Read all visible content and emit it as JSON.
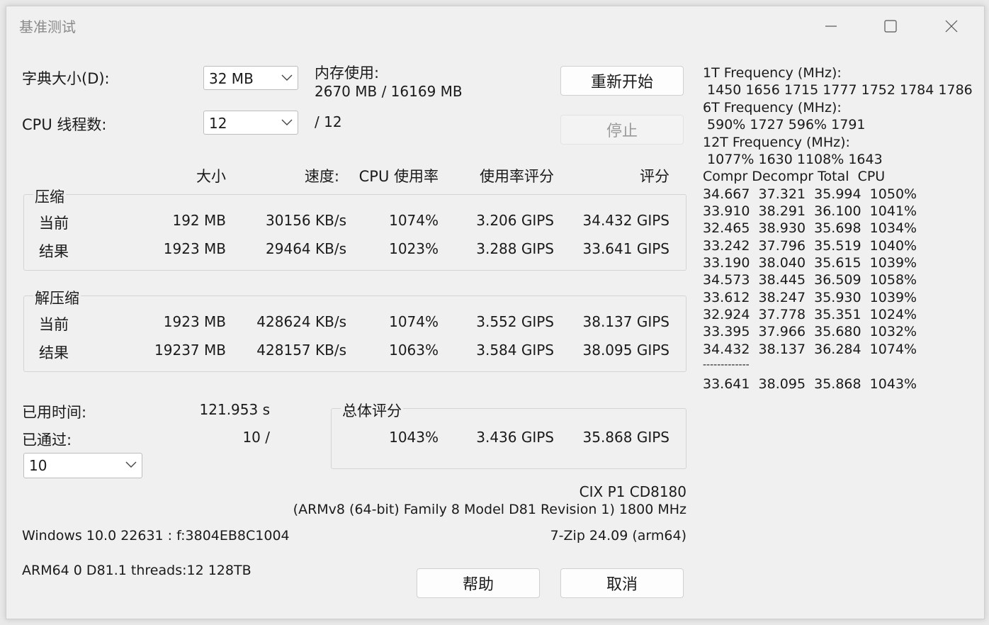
{
  "window": {
    "title": "基准测试",
    "controls": {
      "minimize": "minimize-icon",
      "maximize": "maximize-icon",
      "close": "close-icon"
    }
  },
  "settings": {
    "dict_label": "字典大小(D):",
    "dict_value": "32 MB",
    "threads_label": "CPU 线程数:",
    "threads_value": "12",
    "threads_max": "/ 12",
    "mem_label": "内存使用:",
    "mem_value": "2670 MB / 16169 MB"
  },
  "buttons": {
    "restart": "重新开始",
    "stop": "停止",
    "help": "帮助",
    "cancel": "取消"
  },
  "table": {
    "headers": {
      "size": "大小",
      "speed": "速度:",
      "cpu": "CPU 使用率",
      "usage_rating": "使用率评分",
      "rating": "评分"
    },
    "compress": {
      "title": "压缩",
      "current": {
        "label": "当前",
        "size": "192 MB",
        "speed": "30156 KB/s",
        "cpu": "1074%",
        "usage_rating": "3.206 GIPS",
        "rating": "34.432 GIPS"
      },
      "result": {
        "label": "结果",
        "size": "1923 MB",
        "speed": "29464 KB/s",
        "cpu": "1023%",
        "usage_rating": "3.288 GIPS",
        "rating": "33.641 GIPS"
      }
    },
    "decompress": {
      "title": "解压缩",
      "current": {
        "label": "当前",
        "size": "1923 MB",
        "speed": "428624 KB/s",
        "cpu": "1074%",
        "usage_rating": "3.552 GIPS",
        "rating": "38.137 GIPS"
      },
      "result": {
        "label": "结果",
        "size": "19237 MB",
        "speed": "428157 KB/s",
        "cpu": "1063%",
        "usage_rating": "3.584 GIPS",
        "rating": "38.095 GIPS"
      }
    }
  },
  "time": {
    "elapsed_label": "已用时间:",
    "elapsed_value": "121.953 s",
    "passes_label": "已通过:",
    "passes_value": "10 /",
    "passes_select": "10"
  },
  "total": {
    "title": "总体评分",
    "cpu": "1043%",
    "usage_rating": "3.436 GIPS",
    "rating": "35.868 GIPS"
  },
  "system": {
    "cpu_name": "CIX P1 CD8180",
    "cpu_desc": "(ARMv8 (64-bit) Family 8 Model D81 Revision  1) 1800 MHz",
    "os": "Windows 10.0 22631 : f:3804EB8C1004",
    "version": "7-Zip 24.09 (arm64)",
    "arch": "ARM64 0 D81.1 threads:12 128TB"
  },
  "side_panel": {
    "lines": [
      "1T Frequency (MHz):",
      " 1450 1656 1715 1777 1752 1784 1786",
      "6T Frequency (MHz):",
      " 590% 1727 596% 1791",
      "12T Frequency (MHz):",
      " 1077% 1630 1108% 1643",
      "Compr Decompr Total  CPU",
      "34.667  37.321  35.994  1050%",
      "33.910  38.291  36.100  1041%",
      "32.465  38.930  35.698  1034%",
      "33.242  37.796  35.519  1040%",
      "33.190  38.040  35.615  1039%",
      "34.573  38.445  36.509  1058%",
      "33.612  38.247  35.930  1039%",
      "32.924  37.778  35.351  1024%",
      "33.395  37.966  35.680  1032%",
      "34.432  38.137  36.284  1074%",
      "-------------",
      "33.641  38.095  35.868  1043%"
    ]
  }
}
